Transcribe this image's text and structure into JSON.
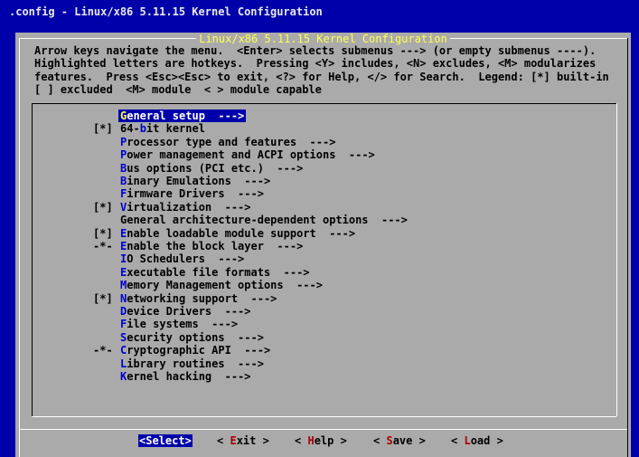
{
  "window_title": ".config - Linux/x86 5.11.15 Kernel Configuration",
  "dialog_title": "Linux/x86 5.11.15 Kernel Configuration",
  "help_lines": [
    "Arrow keys navigate the menu.  <Enter> selects submenus ---> (or empty submenus ----).",
    "Highlighted letters are hotkeys.  Pressing <Y> includes, <N> excludes, <M> modularizes",
    "features.  Press <Esc><Esc> to exit, <?> for Help, </> for Search.  Legend: [*] built-in",
    "[ ] excluded  <M> module  < > module capable"
  ],
  "menu_items": [
    {
      "prefix": "",
      "label": "General setup  --->",
      "hotkey_index": 0,
      "selected": true
    },
    {
      "prefix": "[*]",
      "label": "64-bit kernel",
      "hotkey_index": 3,
      "selected": false
    },
    {
      "prefix": "",
      "label": "Processor type and features  --->",
      "hotkey_index": 0,
      "selected": false
    },
    {
      "prefix": "",
      "label": "Power management and ACPI options  --->",
      "hotkey_index": 0,
      "selected": false
    },
    {
      "prefix": "",
      "label": "Bus options (PCI etc.)  --->",
      "hotkey_index": 0,
      "selected": false
    },
    {
      "prefix": "",
      "label": "Binary Emulations  --->",
      "hotkey_index": 0,
      "selected": false
    },
    {
      "prefix": "",
      "label": "Firmware Drivers  --->",
      "hotkey_index": 0,
      "selected": false
    },
    {
      "prefix": "[*]",
      "label": "Virtualization  --->",
      "hotkey_index": 0,
      "selected": false
    },
    {
      "prefix": "",
      "label": "General architecture-dependent options  --->",
      "hotkey_index": -1,
      "selected": false
    },
    {
      "prefix": "[*]",
      "label": "Enable loadable module support  --->",
      "hotkey_index": 0,
      "selected": false
    },
    {
      "prefix": "-*-",
      "label": "Enable the block layer  --->",
      "hotkey_index": 0,
      "selected": false
    },
    {
      "prefix": "",
      "label": "IO Schedulers  --->",
      "hotkey_index": 0,
      "selected": false
    },
    {
      "prefix": "",
      "label": "Executable file formats  --->",
      "hotkey_index": 0,
      "selected": false
    },
    {
      "prefix": "",
      "label": "Memory Management options  --->",
      "hotkey_index": 0,
      "selected": false
    },
    {
      "prefix": "[*]",
      "label": "Networking support  --->",
      "hotkey_index": 0,
      "selected": false
    },
    {
      "prefix": "",
      "label": "Device Drivers  --->",
      "hotkey_index": 0,
      "selected": false
    },
    {
      "prefix": "",
      "label": "File systems  --->",
      "hotkey_index": 0,
      "selected": false
    },
    {
      "prefix": "",
      "label": "Security options  --->",
      "hotkey_index": 0,
      "selected": false
    },
    {
      "prefix": "-*-",
      "label": "Cryptographic API  --->",
      "hotkey_index": 0,
      "selected": false
    },
    {
      "prefix": "",
      "label": "Library routines  --->",
      "hotkey_index": 0,
      "selected": false
    },
    {
      "prefix": "",
      "label": "Kernel hacking  --->",
      "hotkey_index": 0,
      "selected": false
    }
  ],
  "buttons": [
    {
      "id": "select",
      "text": "<Select>",
      "hotkey_index": -1,
      "selected": true
    },
    {
      "id": "exit",
      "text": "< Exit >",
      "hotkey_index": 2,
      "selected": false
    },
    {
      "id": "help",
      "text": "< Help >",
      "hotkey_index": 2,
      "selected": false
    },
    {
      "id": "save",
      "text": "< Save >",
      "hotkey_index": 2,
      "selected": false
    },
    {
      "id": "load",
      "text": "< Load >",
      "hotkey_index": 2,
      "selected": false
    }
  ],
  "colors": {
    "screen_background": "#0000aa",
    "dialog_background": "#aaaaaa",
    "dialog_title": "#ffff55",
    "hotkey": "#0000cc",
    "button_hotkey": "#aa0000",
    "highlight_background": "#0000aa"
  }
}
